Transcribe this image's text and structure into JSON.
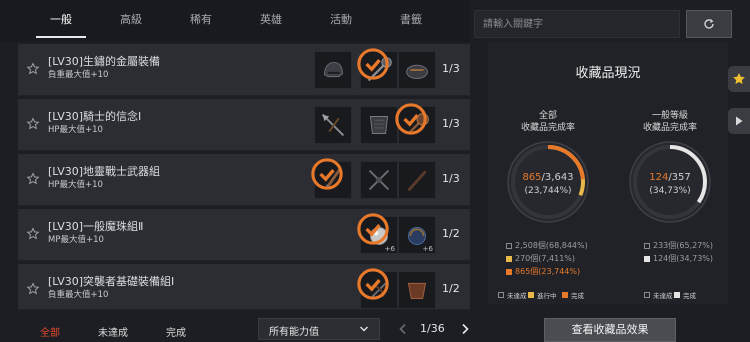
{
  "tabs": [
    {
      "label": "一般",
      "active": true
    },
    {
      "label": "高級",
      "active": false
    },
    {
      "label": "稀有",
      "active": false
    },
    {
      "label": "英雄",
      "active": false
    },
    {
      "label": "活動",
      "active": false
    },
    {
      "label": "書籤",
      "active": false
    }
  ],
  "search": {
    "placeholder": "請輸入關鍵字"
  },
  "rows": [
    {
      "name": "[LV30]生鏽的金屬裝備",
      "stat": "負重最大值+10",
      "count": "1/3"
    },
    {
      "name": "[LV30]騎士的信念Ⅰ",
      "stat": "HP最大值+10",
      "count": "1/3"
    },
    {
      "name": "[LV30]地靈戰士武器組",
      "stat": "HP最大值+10",
      "count": "1/3"
    },
    {
      "name": "[LV30]一般魔珠組Ⅱ",
      "stat": "MP最大值+10",
      "count": "1/2"
    },
    {
      "name": "[LV30]突襲者基礎裝備組Ⅰ",
      "stat": "負重最大值+10",
      "count": "1/2"
    }
  ],
  "slot_badges": [
    "+6",
    "+6"
  ],
  "filters": {
    "all": "全部",
    "incomplete": "未達成",
    "complete": "完成"
  },
  "ability_select": "所有能力值",
  "pager": {
    "text": "1/36"
  },
  "panel": {
    "title": "收藏品現況",
    "overall": {
      "label_line1": "全部",
      "label_line2": "收藏品完成率",
      "done": "865",
      "total": "/3,643",
      "percent": "(23,744%)",
      "legend": [
        "2,508個(68,844%)",
        "270個(7,411%)",
        "865個(23,744%)"
      ],
      "keys": [
        "未達成",
        "進行中",
        "完成"
      ]
    },
    "general": {
      "label_line1": "一般等級",
      "label_line2": "收藏品完成率",
      "done": "124",
      "total": "/357",
      "percent": "(34,73%)",
      "legend": [
        "233個(65,27%)",
        "124個(34,73%)"
      ],
      "keys": [
        "未達成",
        "完成"
      ]
    }
  },
  "view_effects_button": "查看收藏品效果",
  "colors": {
    "accent_orange": "#e8782a",
    "progress_yellow": "#e8b84a",
    "active_red": "#e84a2a",
    "gauge_white": "#e6e6e6"
  }
}
